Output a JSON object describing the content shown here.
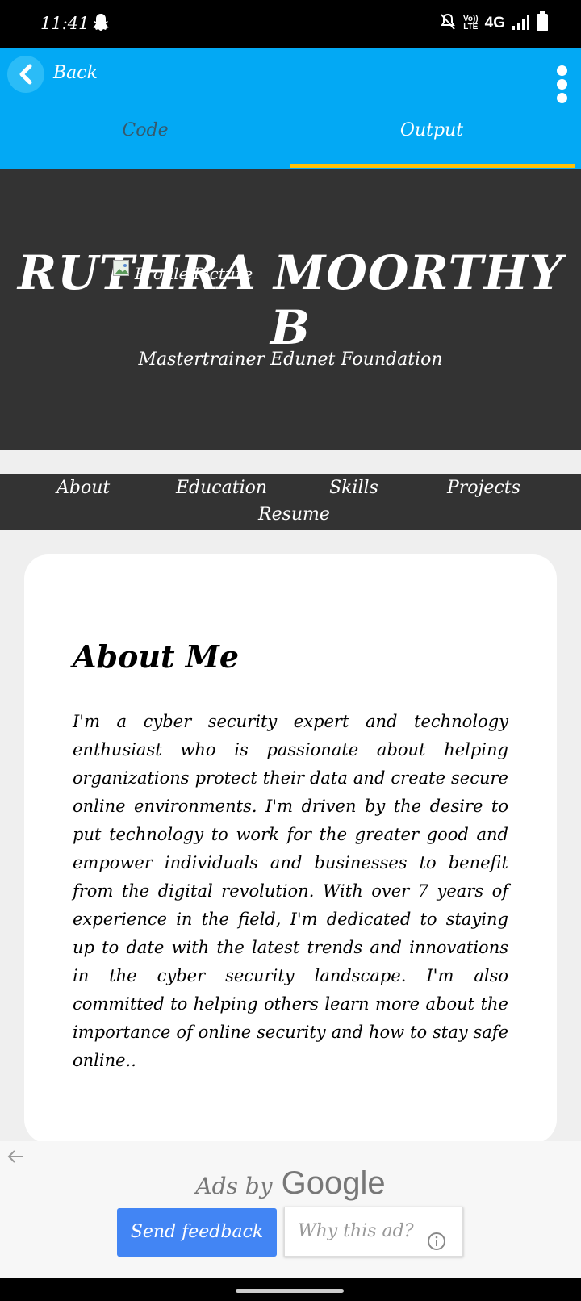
{
  "status_bar": {
    "time": "11:41",
    "network": "4G",
    "volte_line1": "Vo))",
    "volte_line2": "LTE"
  },
  "app_bar": {
    "back_label": "Back",
    "tabs": [
      {
        "label": "Code",
        "active": false
      },
      {
        "label": "Output",
        "active": true
      }
    ],
    "colors": {
      "bar": "#03a9f4",
      "indicator": "#ffc107"
    }
  },
  "hero": {
    "name": "RUTHRA MOORTHY B",
    "profile_picture_alt": "Profile Picture",
    "subtitle": "Mastertrainer Edunet Foundation"
  },
  "site_nav": {
    "items": [
      "About",
      "Education",
      "Skills",
      "Projects",
      "Resume"
    ]
  },
  "about": {
    "heading": "About Me",
    "body": "I'm a cyber security expert and technology enthusiast who is passionate about helping organizations protect their data and create secure online environments. I'm driven by the desire to put technology to work for the greater good and empower individuals and businesses to benefit from the digital revolution. With over 7 years of experience in the field, I'm dedicated to staying up to date with the latest trends and innovations in the cyber security landscape. I'm also committed to helping others learn more about the importance of online security and how to stay safe online.."
  },
  "ad": {
    "ads_by": "Ads by",
    "brand": "Google",
    "send_feedback": "Send feedback",
    "why_this_ad": "Why this ad?"
  }
}
